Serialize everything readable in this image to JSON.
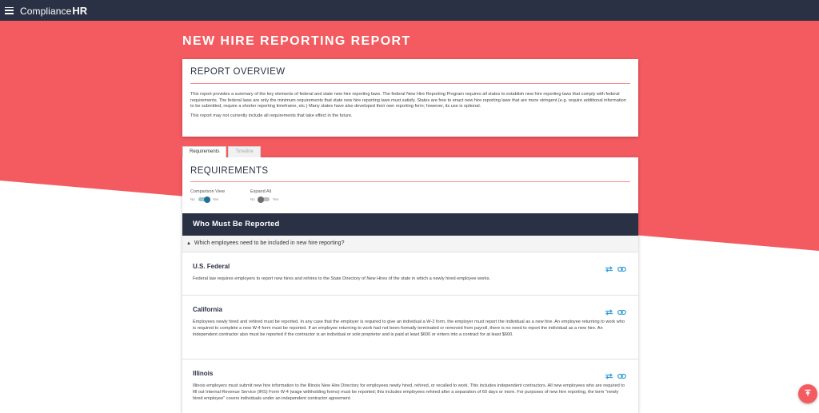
{
  "app": {
    "brand_light": "Compliance",
    "brand_bold": "HR"
  },
  "page": {
    "title": "NEW HIRE REPORTING REPORT"
  },
  "overview": {
    "heading": "REPORT OVERVIEW",
    "paragraph1": "This report provides a summary of the key elements of federal and state new hire reporting laws. The federal New Hire Reporting Program requires all states to establish new hire reporting laws that comply with federal requirements. The federal laws are only the minimum requirements that state new hire reporting laws must satisfy. States are free to enact new hire reporting laws that are more stringent (e.g. require additional information to be submitted, require a shorter reporting timeframe, etc.) Many states have also developed their own reporting form; however, its use is optional.",
    "paragraph2": "This report may not currently include all requirements that take effect in the future."
  },
  "tabs": [
    {
      "label": "Requirements",
      "active": true
    },
    {
      "label": "Timeline",
      "active": false
    }
  ],
  "requirements": {
    "heading": "REQUIREMENTS",
    "toggles": [
      {
        "label": "Comparison View",
        "off_label": "No",
        "on_label": "Yes",
        "state": "on"
      },
      {
        "label": "Expand All",
        "off_label": "No",
        "on_label": "Yes",
        "state": "off"
      }
    ],
    "section_title": "Who Must Be Reported",
    "question": "Which employees need to be included in new hire reporting?",
    "entries": [
      {
        "jurisdiction": "U.S. Federal",
        "text": "Federal law requires employers to report new hires and rehires to the State Directory of New Hires of the state in which a newly hired employee works."
      },
      {
        "jurisdiction": "California",
        "text": "Employees newly hired and rehired must be reported. In any case that the employer is required to give an individual a W-2 form, the employer must report the individual as a new hire. An employee returning to work who is required to complete a new W-4 form must be reported. If an employee returning to work had not been formally terminated or removed from payroll, there is no need to report the individual as a new hire. An independent contractor also must be reported if the contractor is an individual or sole proprietor and is paid at least $600 or enters into a contract for at least $600."
      },
      {
        "jurisdiction": "Illinois",
        "text": "Illinois employers must submit new hire information to the Illinois New Hire Directory for employees newly hired, rehired, or recalled to work. This includes independent contractors. All new employees who are required to fill out Internal Revenue Service (IRS) Form W-4 (wage withholding forms) must be reported; this includes employees rehired after a separation of 60 days or more. For purposes of new hire reporting, the term \"newly hired employee\" covers individuals under an independent contractor agreement."
      }
    ]
  },
  "colors": {
    "accent": "#f35b60",
    "navy": "#2b3144",
    "link_blue": "#3a9fd8",
    "toggle_on": "#1f6f97"
  },
  "icons": {
    "compare": "swap-arrows-icon",
    "link": "chain-link-icon",
    "fab": "scroll-to-top-icon",
    "menu": "hamburger-menu-icon"
  }
}
